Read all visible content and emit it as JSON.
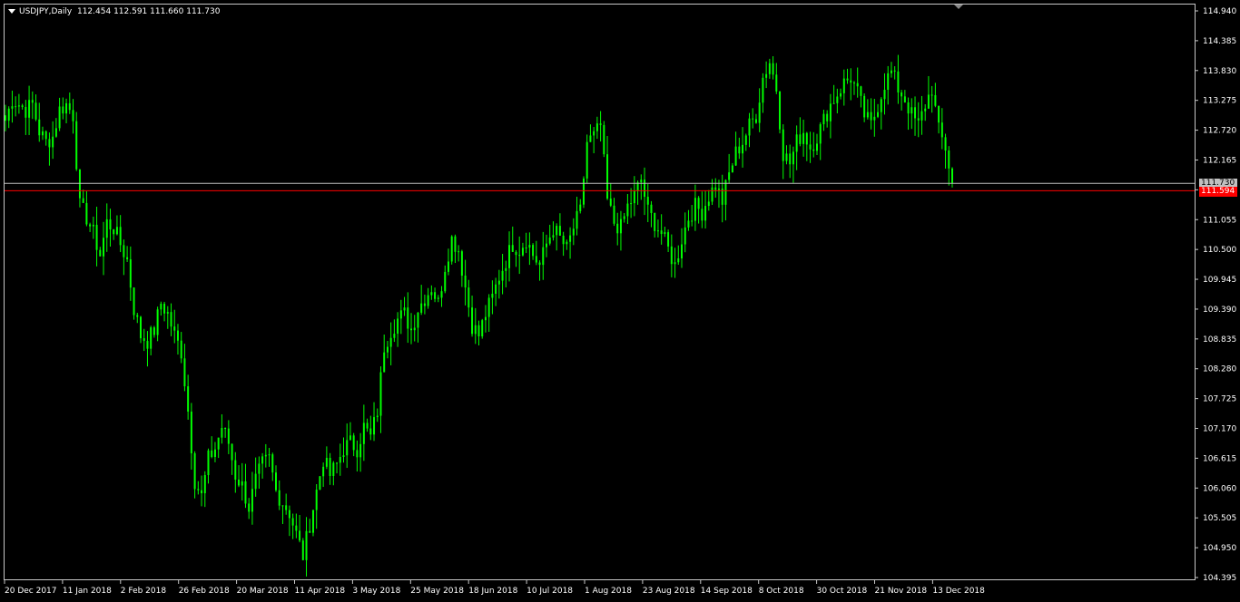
{
  "header": {
    "symbol_timeframe": "USDJPY,Daily",
    "ohlc": "112.454 112.591 111.660 111.730"
  },
  "colors": {
    "background": "#000000",
    "candle": "#00ff00",
    "grid_frame": "#c8c8c8",
    "bid_line": "#c0c0c0",
    "ask_line": "#ff0000"
  },
  "price_labels": {
    "bid": "111.730",
    "ask": "111.594"
  },
  "chart_data": {
    "type": "candlestick",
    "y_ticks": [
      "114.940",
      "114.385",
      "113.830",
      "113.275",
      "112.720",
      "112.165",
      "111.610",
      "111.055",
      "110.500",
      "109.945",
      "109.390",
      "108.835",
      "108.280",
      "107.725",
      "107.170",
      "106.615",
      "106.060",
      "105.505",
      "104.950",
      "104.395"
    ],
    "x_ticks": [
      "20 Dec 2017",
      "11 Jan 2018",
      "2 Feb 2018",
      "26 Feb 2018",
      "20 Mar 2018",
      "11 Apr 2018",
      "3 May 2018",
      "25 May 2018",
      "18 Jun 2018",
      "10 Jul 2018",
      "1 Aug 2018",
      "23 Aug 2018",
      "14 Sep 2018",
      "8 Oct 2018",
      "30 Oct 2018",
      "21 Nov 2018",
      "13 Dec 2018"
    ],
    "ylim": [
      104.395,
      114.94
    ],
    "horizontal_lines": [
      111.73,
      111.594
    ],
    "closes_approx": [
      112.9,
      113.3,
      113.2,
      113.1,
      113.2,
      112.7,
      112.5,
      112.6,
      113.1,
      113.2,
      113.0,
      111.3,
      111.1,
      110.8,
      110.4,
      111.0,
      110.9,
      110.6,
      110.3,
      109.4,
      108.9,
      108.8,
      109.0,
      109.5,
      109.3,
      108.9,
      108.6,
      107.5,
      106.2,
      105.9,
      106.6,
      106.8,
      107.2,
      106.9,
      106.3,
      106.1,
      105.7,
      106.2,
      106.5,
      106.6,
      106.0,
      105.8,
      105.6,
      105.2,
      104.8,
      105.4,
      106.0,
      106.6,
      106.3,
      106.5,
      106.8,
      106.9,
      106.8,
      107.2,
      107.0,
      107.5,
      108.7,
      109.0,
      109.2,
      109.3,
      109.0,
      109.4,
      109.6,
      109.8,
      109.5,
      110.2,
      110.7,
      110.5,
      109.8,
      109.1,
      108.9,
      109.3,
      109.6,
      110.0,
      110.3,
      110.6,
      110.5,
      110.7,
      110.4,
      110.2,
      110.6,
      110.9,
      110.7,
      110.5,
      110.9,
      111.2,
      112.5,
      112.6,
      112.8,
      111.4,
      111.0,
      110.9,
      111.3,
      111.5,
      111.8,
      111.2,
      111.0,
      110.8,
      110.5,
      110.2,
      110.7,
      111.1,
      111.3,
      111.2,
      111.5,
      111.7,
      111.4,
      111.9,
      112.3,
      112.5,
      112.8,
      113.0,
      113.7,
      114.0,
      113.5,
      112.3,
      112.1,
      112.5,
      112.7,
      112.4,
      112.6,
      112.9,
      113.2,
      113.4,
      113.6,
      113.7,
      113.4,
      113.0,
      112.8,
      113.2,
      113.6,
      113.8,
      113.5,
      113.3,
      113.0,
      112.8,
      113.2,
      113.5,
      112.7,
      112.4,
      111.73
    ]
  }
}
